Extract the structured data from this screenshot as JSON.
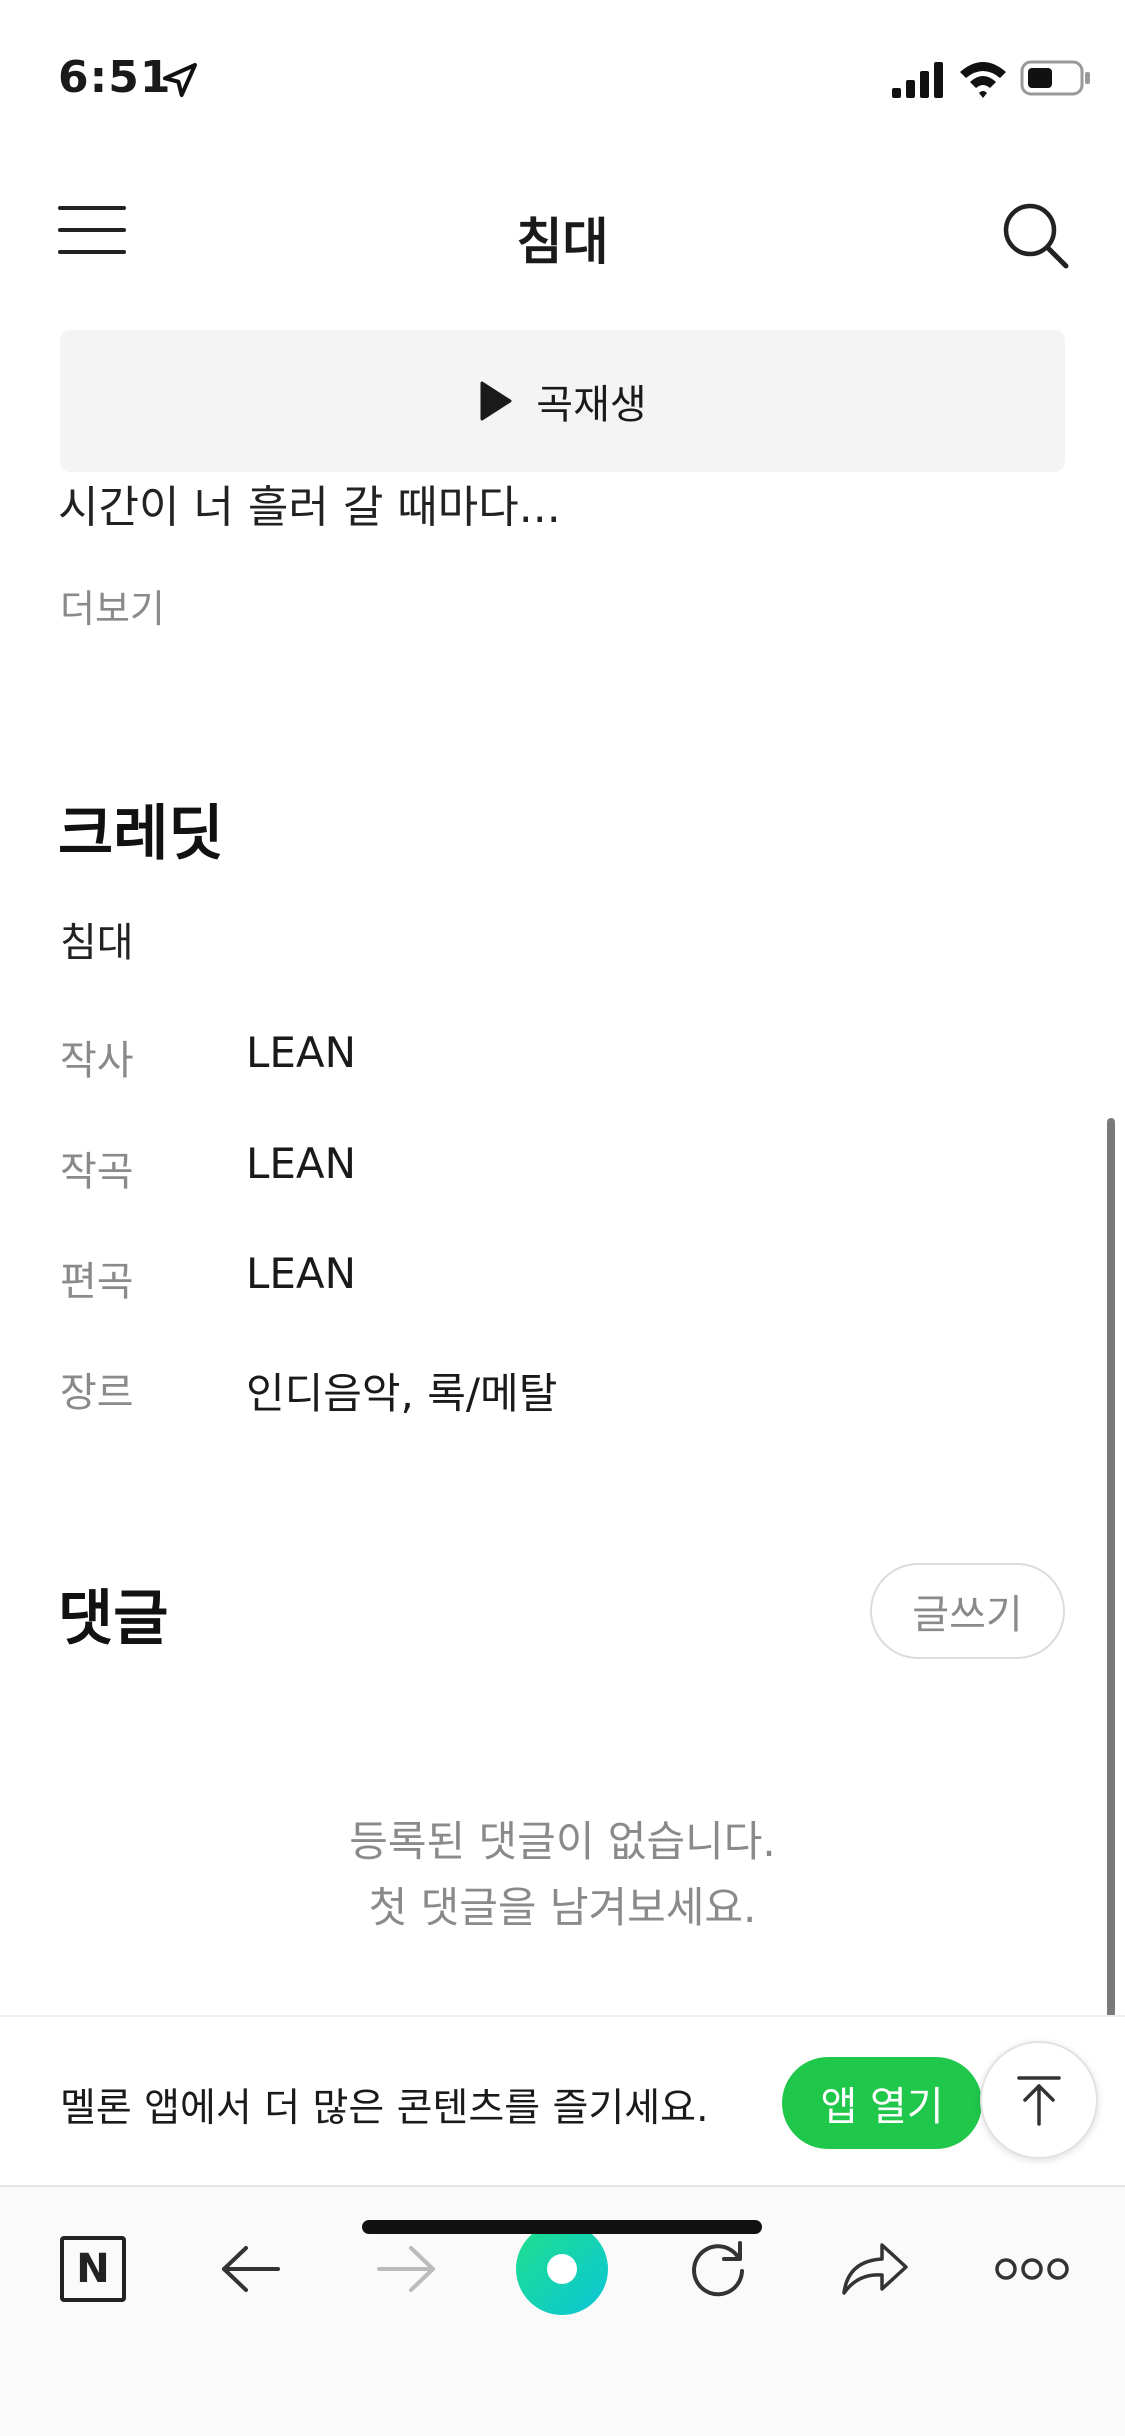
{
  "status_bar": {
    "time": "6:51"
  },
  "header": {
    "title": "침대"
  },
  "play_bar": {
    "label": "곡재생"
  },
  "lyrics": {
    "partial_line": "시간이 너 흘러 갈 때마다...",
    "more_label": "더보기"
  },
  "credits": {
    "heading": "크레딧",
    "song_title": "침대",
    "rows": [
      {
        "key": "작사",
        "value": "LEAN"
      },
      {
        "key": "작곡",
        "value": "LEAN"
      },
      {
        "key": "편곡",
        "value": "LEAN"
      },
      {
        "key": "장르",
        "value": "인디음악, 록/메탈"
      }
    ]
  },
  "comments": {
    "heading": "댓글",
    "write_label": "글쓰기",
    "empty_line1": "등록된 댓글이 없습니다.",
    "empty_line2": "첫 댓글을 남겨보세요."
  },
  "promo": {
    "text": "멜론 앱에서 더 많은 콘텐츠를 즐기세요.",
    "open_app_label": "앱 열기"
  },
  "toolbar": {
    "n_label": "N"
  },
  "colors": {
    "accent_green": "#1fc74a",
    "gray_text": "#8a8a8a"
  },
  "icons": [
    "location-arrow-icon",
    "signal-icon",
    "wifi-icon",
    "battery-icon",
    "menu-icon",
    "search-icon",
    "play-icon",
    "arrow-up-icon",
    "naver-n-icon",
    "back-arrow-icon",
    "forward-arrow-icon",
    "green-home-icon",
    "refresh-icon",
    "share-icon",
    "more-dots-icon"
  ]
}
